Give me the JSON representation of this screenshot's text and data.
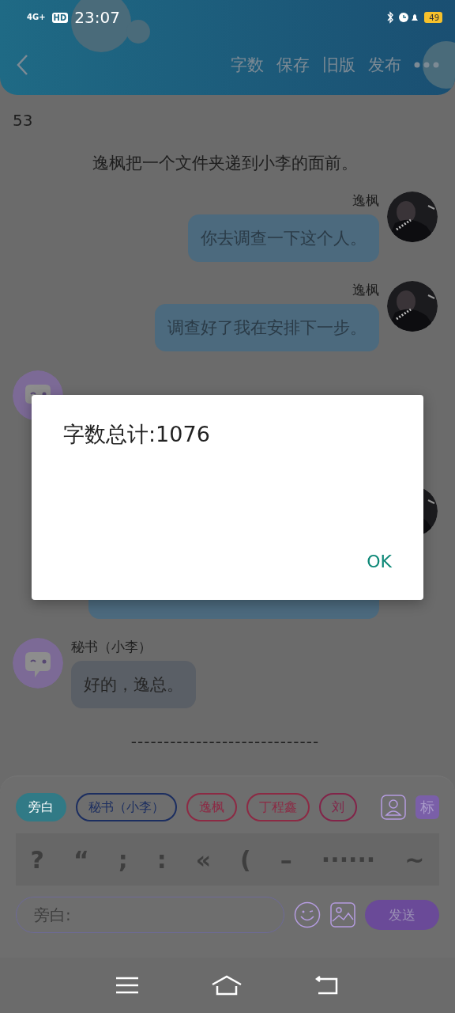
{
  "status_bar": {
    "network": "4G+",
    "hd": "HD",
    "time": "23:07",
    "battery": "49"
  },
  "header": {
    "actions": [
      "字数",
      "保存",
      "旧版",
      "发布"
    ]
  },
  "content": {
    "count": "53",
    "narration": "逸枫把一个文件夹递到小李的面前。",
    "messages": [
      {
        "kind": "right",
        "name": "逸枫",
        "text": "你去调查一下这个人。"
      },
      {
        "kind": "right",
        "name": "逸枫",
        "text": "调查好了我在安排下一步。"
      },
      {
        "kind": "left-covered"
      },
      {
        "kind": "right-covered"
      },
      {
        "kind": "left",
        "name": "秘书（小李）",
        "text": "好的，逸总。"
      }
    ],
    "divider": "-----------------------------"
  },
  "composer": {
    "roles": [
      {
        "label": "旁白",
        "selected": true,
        "color": "#317a86"
      },
      {
        "label": "秘书（小李）",
        "selected": false,
        "color": "#1c2e60"
      },
      {
        "label": "逸枫",
        "selected": false,
        "color": "#8c2a44"
      },
      {
        "label": "丁程鑫",
        "selected": false,
        "color": "#8c2a44"
      },
      {
        "label": "刘",
        "selected": false,
        "color": "#822449"
      }
    ],
    "tag_button": "标",
    "punctuation": [
      "?",
      "“",
      ";",
      ":",
      "«",
      "(",
      "–",
      "······",
      "~"
    ],
    "input": {
      "placeholder": "旁白:"
    },
    "send": "发送"
  },
  "dialog": {
    "message": "字数总计:1076",
    "ok": "OK"
  }
}
